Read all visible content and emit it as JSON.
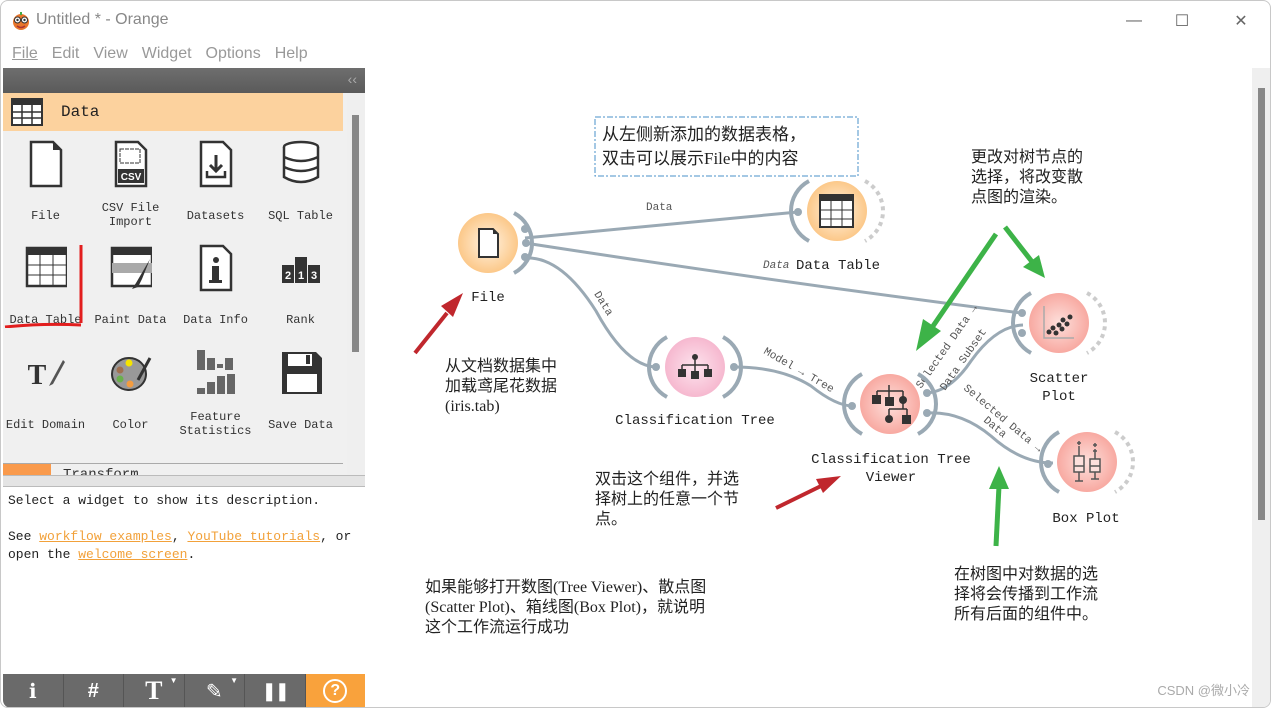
{
  "window": {
    "title": "Untitled * - Orange",
    "controls": {
      "minimize": "—",
      "maximize": "☐",
      "close": "✕"
    }
  },
  "menu": [
    {
      "label": "File",
      "mnemonic": "F"
    },
    {
      "label": "Edit",
      "mnemonic": "E"
    },
    {
      "label": "View",
      "mnemonic": "V"
    },
    {
      "label": "Widget",
      "mnemonic": "W"
    },
    {
      "label": "Options",
      "mnemonic": "O"
    },
    {
      "label": "Help",
      "mnemonic": "H"
    }
  ],
  "left_panel": {
    "collapse_label": "‹‹",
    "category": {
      "label": "Data",
      "icon": "table-icon",
      "color": "#fcd29e"
    },
    "tools": [
      {
        "label": "File",
        "icon": "file-icon"
      },
      {
        "label": "CSV File Import",
        "icon": "csv-icon"
      },
      {
        "label": "Datasets",
        "icon": "download-icon"
      },
      {
        "label": "SQL Table",
        "icon": "database-icon"
      },
      {
        "label": "Data Table",
        "icon": "table-icon"
      },
      {
        "label": "Paint Data",
        "icon": "paint-icon"
      },
      {
        "label": "Data Info",
        "icon": "info-icon"
      },
      {
        "label": "Rank",
        "icon": "rank-icon"
      },
      {
        "label": "Edit Domain",
        "icon": "edit-domain-icon"
      },
      {
        "label": "Color",
        "icon": "palette-icon"
      },
      {
        "label": "Feature Statistics",
        "icon": "bars-icon"
      },
      {
        "label": "Save Data",
        "icon": "save-icon"
      }
    ],
    "next_category": {
      "label": "Transform",
      "color": "#f99a4c"
    },
    "description": {
      "line1": "Select a widget to show its description.",
      "see": "See ",
      "link1": "workflow examples",
      "sep1": ", ",
      "link2": "YouTube tutorials",
      "sep2": ", or",
      "open": "open the ",
      "link3": "welcome screen",
      "end": "."
    },
    "toolbar": [
      {
        "name": "info-button",
        "glyph": "ℹ"
      },
      {
        "name": "grid-button",
        "glyph": "#"
      },
      {
        "name": "text-annotation-button",
        "glyph": "T"
      },
      {
        "name": "arrow-annotation-button",
        "glyph": "✎"
      },
      {
        "name": "pause-button",
        "glyph": "❚❚"
      },
      {
        "name": "help-button",
        "glyph": "?"
      }
    ]
  },
  "canvas": {
    "nodes": [
      {
        "id": "file",
        "label": "File"
      },
      {
        "id": "data-table",
        "label": "Data Table"
      },
      {
        "id": "classification-tree",
        "label": "Classification Tree"
      },
      {
        "id": "tree-viewer",
        "label": "Classification Tree Viewer"
      },
      {
        "id": "scatter-plot",
        "label": "Scatter Plot"
      },
      {
        "id": "box-plot",
        "label": "Box Plot"
      }
    ],
    "links": [
      {
        "from": "file",
        "to": "data-table",
        "label": "Data"
      },
      {
        "from": "file",
        "to": "scatter-plot",
        "label": "Data"
      },
      {
        "from": "file",
        "to": "classification-tree",
        "label": "Data"
      },
      {
        "from": "classification-tree",
        "to": "tree-viewer",
        "label": "Model → Tree"
      },
      {
        "from": "tree-viewer",
        "to": "scatter-plot",
        "label": "Selected Data → Data Subset"
      },
      {
        "from": "tree-viewer",
        "to": "box-plot",
        "label": "Selected Data → Data"
      }
    ],
    "notes": {
      "data_table": [
        "从左侧新添加的数据表格，",
        "双击可以展示File中的内容"
      ],
      "scatter": [
        "更改对树节点的",
        "选择，将改变散",
        "点图的渲染。"
      ],
      "file": [
        "从文档数据集中",
        "加载鸢尾花数据",
        "(iris.tab)"
      ],
      "viewer": [
        "双击这个组件，并选",
        "择树上的任意一个节",
        "点。"
      ],
      "success": [
        "如果能够打开数图(Tree Viewer)、散点图",
        "(Scatter Plot)、箱线图(Box Plot)，就说明",
        "这个工作流运行成功"
      ],
      "propagate": [
        "在树图中对数据的选",
        "择将会传播到工作流",
        "所有后面的组件中。"
      ]
    },
    "watermark": "CSDN @微小冷"
  }
}
